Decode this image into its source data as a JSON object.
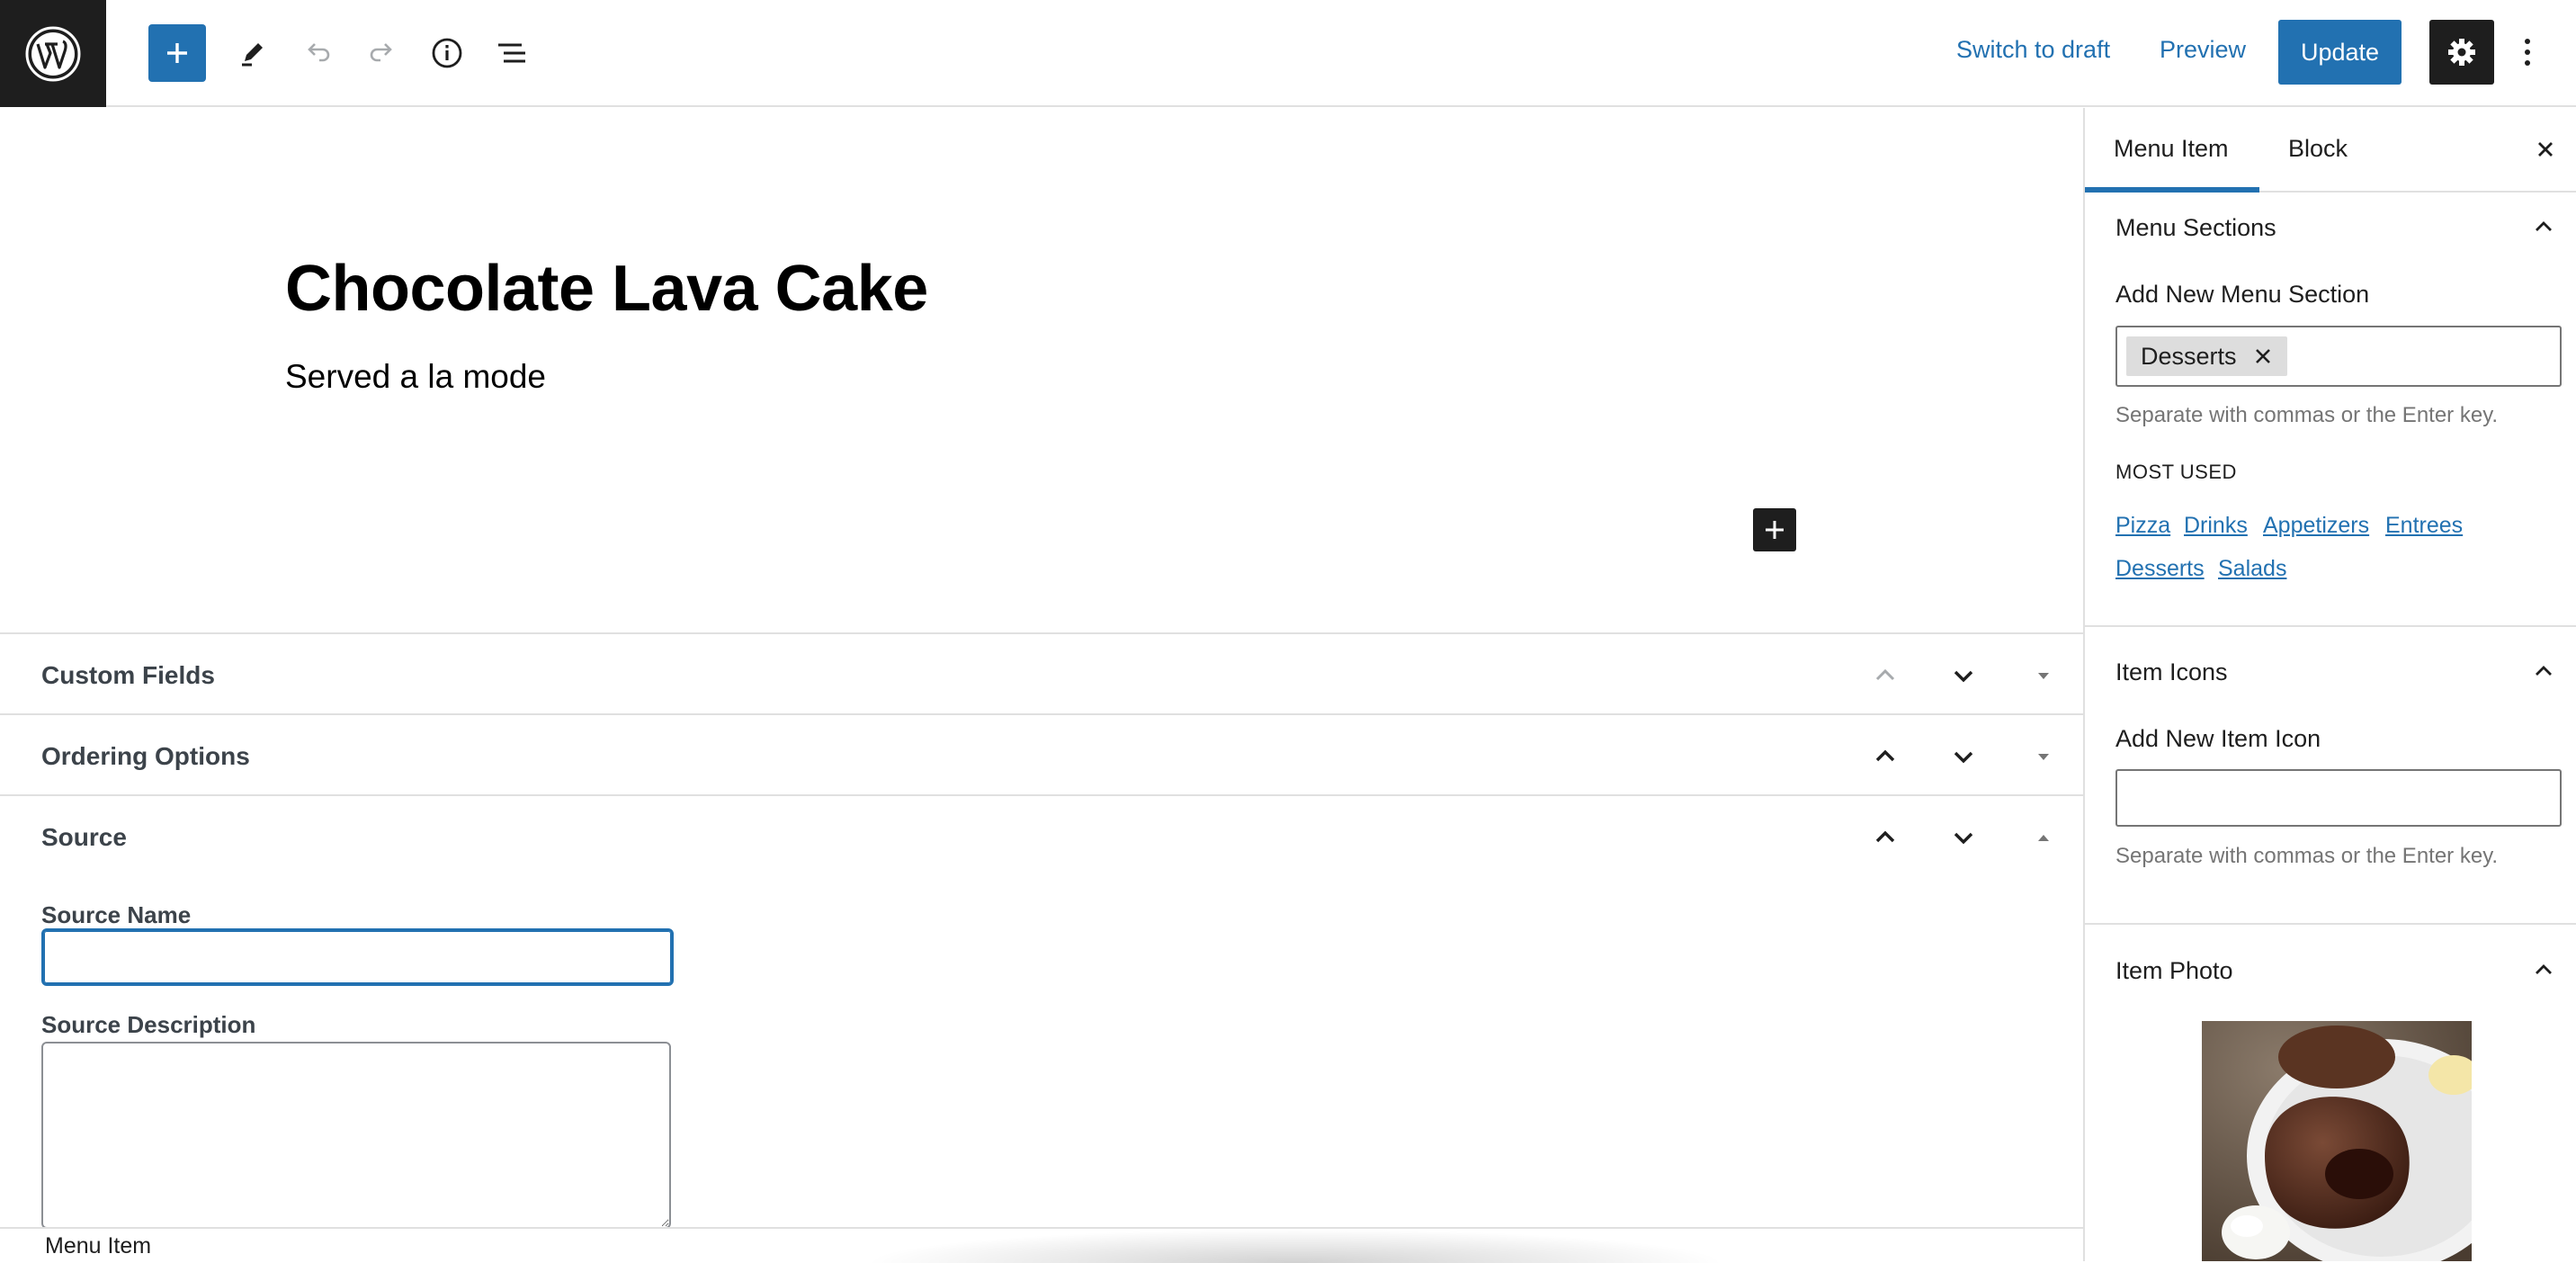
{
  "toolbar": {
    "logo_icon": "wordpress-logo",
    "switch_to_draft": "Switch to draft",
    "preview": "Preview",
    "update": "Update",
    "accent_color": "#2271b1"
  },
  "post": {
    "title": "Chocolate Lava Cake",
    "paragraph": "Served a la mode"
  },
  "metaboxes": {
    "custom_fields": "Custom Fields",
    "ordering_options": "Ordering Options",
    "source": "Source",
    "source_name_label": "Source Name",
    "source_name_value": "",
    "source_description_label": "Source Description",
    "source_description_value": ""
  },
  "footer": {
    "breadcrumb": "Menu Item"
  },
  "sidebar": {
    "tabs": [
      {
        "label": "Menu Item",
        "active": true
      },
      {
        "label": "Block",
        "active": false
      }
    ],
    "menu_sections": {
      "title": "Menu Sections",
      "add_label": "Add New Menu Section",
      "tokens": [
        "Desserts"
      ],
      "help": "Separate with commas or the Enter key.",
      "most_used_label": "MOST USED",
      "most_used": [
        "Pizza",
        "Drinks",
        "Appetizers",
        "Entrees",
        "Desserts",
        "Salads"
      ]
    },
    "item_icons": {
      "title": "Item Icons",
      "add_label": "Add New Item Icon",
      "value": "",
      "help": "Separate with commas or the Enter key."
    },
    "item_photo": {
      "title": "Item Photo"
    }
  }
}
